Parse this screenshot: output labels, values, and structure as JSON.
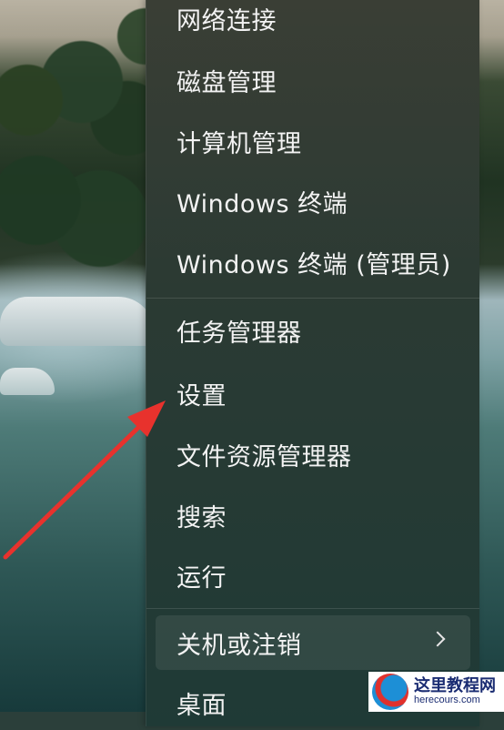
{
  "menu": {
    "items": [
      {
        "label": "网络连接"
      },
      {
        "label": "磁盘管理"
      },
      {
        "label": "计算机管理"
      },
      {
        "label": "Windows 终端"
      },
      {
        "label": "Windows 终端 (管理员)"
      },
      {
        "label": "任务管理器"
      },
      {
        "label": "设置"
      },
      {
        "label": "文件资源管理器"
      },
      {
        "label": "搜索"
      },
      {
        "label": "运行"
      },
      {
        "label": "关机或注销",
        "has_submenu": true
      },
      {
        "label": "桌面"
      }
    ],
    "highlighted_item": "关机或注销"
  },
  "annotation": {
    "color": "#e8322d",
    "points_to": "设置"
  },
  "watermark": {
    "text_cn": "这里教程网",
    "text_en": "herecours.com"
  }
}
